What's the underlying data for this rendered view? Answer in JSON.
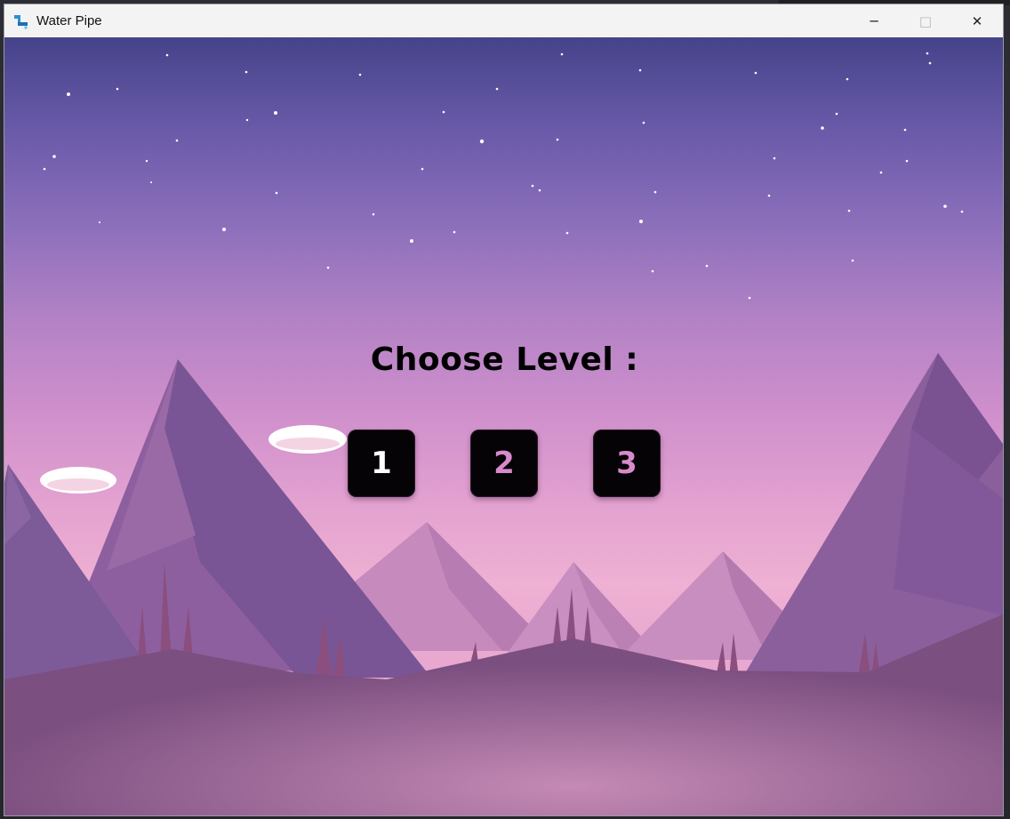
{
  "window": {
    "title": "Water Pipe",
    "controls": {
      "minimize": "─",
      "maximize": "□",
      "close": "✕"
    }
  },
  "game": {
    "heading": "Choose Level :",
    "levels": [
      {
        "label": "1"
      },
      {
        "label": "2"
      },
      {
        "label": "3"
      }
    ]
  },
  "icons": {
    "app": "water-pipe-app-icon",
    "minimize": "minimize-icon",
    "maximize": "maximize-icon",
    "close": "close-icon"
  },
  "colors": {
    "sky_top": "#45438a",
    "sky_horizon": "#eeb0d3",
    "button_bg": "#050305",
    "level_1_text": "#ffffff",
    "level_2_3_text": "#d98acb"
  }
}
